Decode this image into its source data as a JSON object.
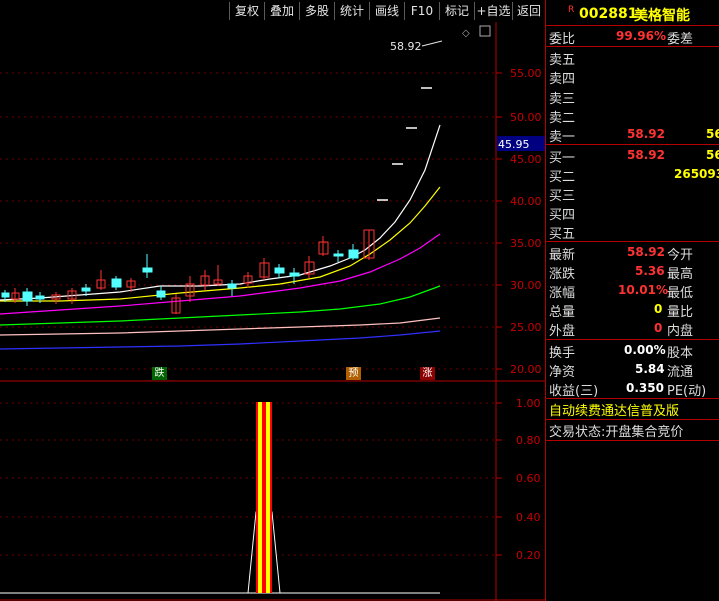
{
  "toolbar": {
    "buttons": [
      "复权",
      "叠加",
      "多股",
      "统计",
      "画线",
      "F10",
      "标记",
      "+自选",
      "返回"
    ]
  },
  "chart": {
    "price_axis": [
      "55.00",
      "50.00",
      "45.00",
      "40.00",
      "35.00",
      "30.00",
      "25.00",
      "20.00"
    ],
    "current_price_tag": "45.95",
    "high_label": "58.92",
    "markers": {
      "die": "跌",
      "yu": "预",
      "zhang": "涨"
    },
    "indicator_axis": [
      "1.00",
      "0.80",
      "0.60",
      "0.40",
      "0.20"
    ],
    "colors": {
      "up": "#ff3232",
      "down": "#54ffff",
      "ma1": "#ffffff",
      "ma2": "#ffff00",
      "ma3": "#ff00ff",
      "ma4": "#00ff00",
      "ma5": "#ffc0c0",
      "ma6": "#3030ff",
      "signal": "#ffff00"
    }
  },
  "quote": {
    "r_mark": "R",
    "code": "002881",
    "name": "美格智能",
    "weibi_label": "委比",
    "weibi_value": "99.96%",
    "weicha_label": "委差",
    "sell": [
      {
        "label": "卖五",
        "price": "",
        "vol": ""
      },
      {
        "label": "卖四",
        "price": "",
        "vol": ""
      },
      {
        "label": "卖三",
        "price": "",
        "vol": ""
      },
      {
        "label": "卖二",
        "price": "",
        "vol": ""
      },
      {
        "label": "卖一",
        "price": "58.92",
        "vol": "56"
      }
    ],
    "buy": [
      {
        "label": "买一",
        "price": "58.92",
        "vol": "56"
      },
      {
        "label": "买二",
        "price": "",
        "vol": "265093"
      },
      {
        "label": "买三",
        "price": "",
        "vol": ""
      },
      {
        "label": "买四",
        "price": "",
        "vol": ""
      },
      {
        "label": "买五",
        "price": "",
        "vol": ""
      }
    ],
    "stats": [
      {
        "label": "最新",
        "value": "58.92",
        "label2": "今开"
      },
      {
        "label": "涨跌",
        "value": "5.36",
        "label2": "最高"
      },
      {
        "label": "涨幅",
        "value": "10.01%",
        "label2": "最低"
      },
      {
        "label": "总量",
        "value": "0",
        "label2": "量比"
      },
      {
        "label": "外盘",
        "value": "0",
        "label2": "内盘"
      }
    ],
    "fundamentals": [
      {
        "label": "换手",
        "value": "0.00%",
        "label2": "股本"
      },
      {
        "label": "净资",
        "value": "5.84",
        "label2": "流通"
      },
      {
        "label": "收益(三)",
        "value": "0.350",
        "label2": "PE(动)"
      }
    ],
    "ticker_text": "自动续费通达信普及版",
    "trade_status": "交易状态:开盘集合竞价"
  }
}
